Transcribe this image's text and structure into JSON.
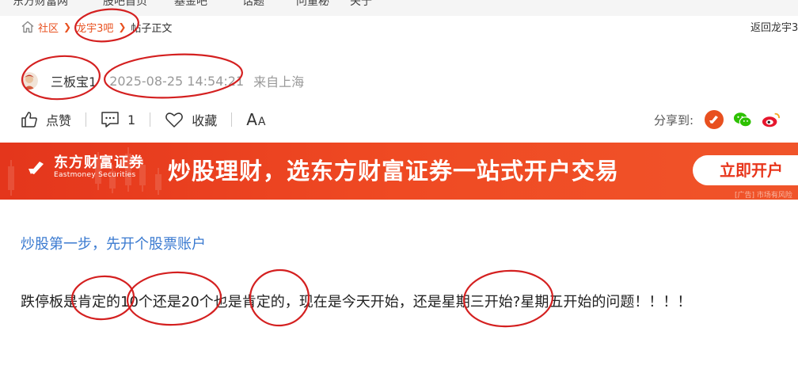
{
  "topnav": {
    "items": [
      "东方财富网",
      "股吧首页",
      "基金吧",
      "话题",
      "问董秘",
      "关于"
    ]
  },
  "breadcrumb": {
    "home_label": "社区",
    "bar_label": "龙宇3吧",
    "current_label": "帖子正文",
    "back_label": "返回龙宇3吧"
  },
  "author": {
    "name": "三板宝1",
    "post_time": "2025-08-25 14:54:21",
    "location": "来自上海"
  },
  "actions": {
    "like_label": "点赞",
    "comment_count": "1",
    "collect_label": "收藏",
    "font_big": "A",
    "font_small": "A",
    "share_label": "分享到:"
  },
  "banner": {
    "logo_cn": "东方财富证券",
    "logo_en": "Eastmoney Securities",
    "slogan": "炒股理财，选东方财富证券一站式开户交易",
    "cta": "立即开户",
    "disclaimer": "[广告] 市场有风险"
  },
  "content": {
    "link_text": "炒股第一步，先开个股票账户",
    "body": "跌停板是肯定的10个还是20个也是肯定的，现在是今天开始，还是星期三开始?星期五开始的问题！！！！"
  },
  "colors": {
    "accent": "#e8501f",
    "link": "#3a7ad0",
    "banner": "#ef4a23",
    "annotation": "#d42020"
  }
}
